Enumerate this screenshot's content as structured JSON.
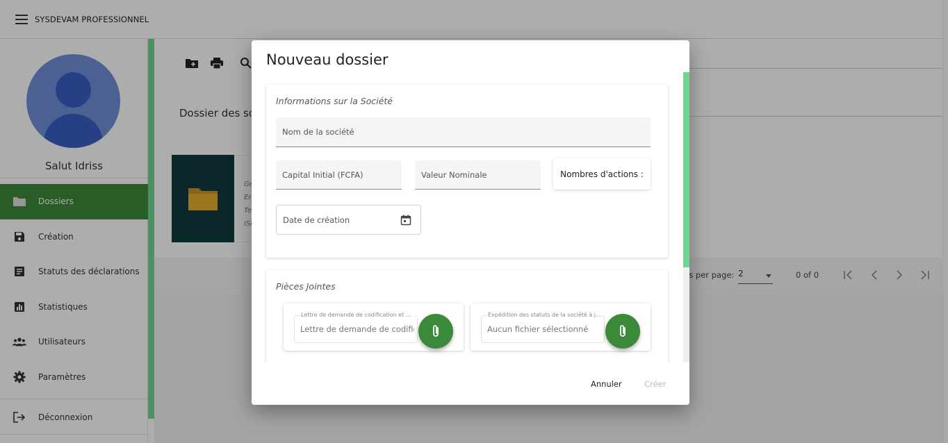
{
  "app": {
    "title": "SYSDEVAM PROFESSIONNEL"
  },
  "sidebar": {
    "greeting": "Salut Idriss",
    "items": [
      {
        "label": "Dossiers",
        "icon": "folder-icon",
        "active": true
      },
      {
        "label": "Création",
        "icon": "save-icon",
        "active": false
      },
      {
        "label": "Statuts des déclarations",
        "icon": "document-list-icon",
        "active": false
      },
      {
        "label": "Statistiques",
        "icon": "bar-chart-icon",
        "active": false
      },
      {
        "label": "Utilisateurs",
        "icon": "users-icon",
        "active": false
      },
      {
        "label": "Paramètres",
        "icon": "gear-icon",
        "active": false
      }
    ],
    "logout": {
      "label": "Déconnexion",
      "icon": "logout-icon"
    }
  },
  "main": {
    "section_title": "Dossier des soc",
    "card_lines": [
      "Ge",
      "En",
      "Te",
      "ISI"
    ],
    "pager": {
      "label": "ns per page:",
      "page_size": "2",
      "range": "0 of 0"
    }
  },
  "dialog": {
    "title": "Nouveau dossier",
    "company_section": {
      "title": "Informations sur la Société",
      "name_placeholder": "Nom de la société",
      "capital_placeholder": "Capital Initial (FCFA)",
      "nominal_placeholder": "Valeur Nominale",
      "shares_label": "Nombres d'actions :",
      "date_placeholder": "Date de création"
    },
    "attachments_section": {
      "title": "Pièces Jointes",
      "items": [
        {
          "label": "Lettre de demande de codification et d...",
          "value": "Lettre de demande de codifica"
        },
        {
          "label": "Expédition des statuts de la société à j...",
          "value": "Aucun fichier sélectionné"
        }
      ]
    },
    "actions": {
      "cancel": "Annuler",
      "create": "Créer"
    }
  },
  "colors": {
    "accent_green": "#3b8a3b",
    "scroll_green": "#6cd88f",
    "avatar_blue": "#6f8fd8"
  }
}
